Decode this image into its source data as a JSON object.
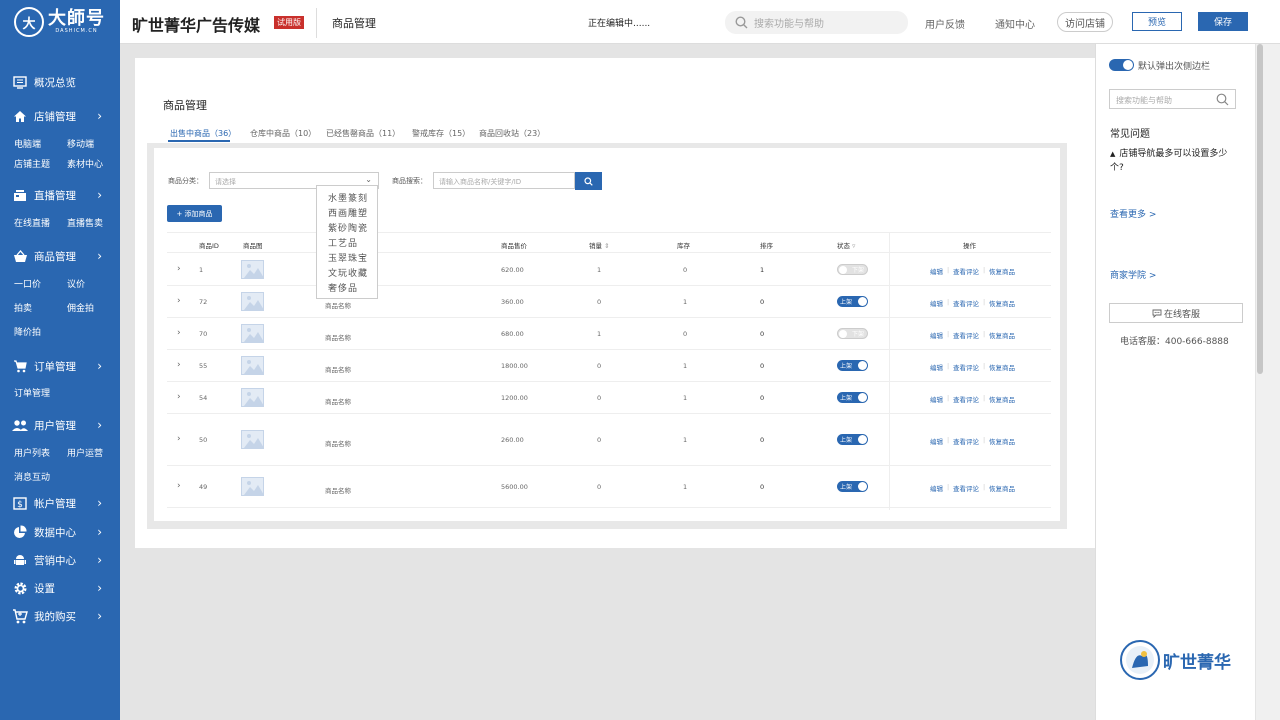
{
  "sidebar": {
    "logo_mark": "大",
    "logo_text": "大師号",
    "logo_sub": "DASHICM.CN",
    "items": [
      {
        "label": "概况总览",
        "subs": []
      },
      {
        "label": "店铺管理",
        "subs": [
          "电脑端",
          "移动端",
          "店铺主题",
          "素材中心"
        ]
      },
      {
        "label": "直播管理",
        "subs": [
          "在线直播",
          "直播售卖"
        ]
      },
      {
        "label": "商品管理",
        "subs": [
          "一口价",
          "议价",
          "拍卖",
          "佣金拍",
          "降价拍"
        ]
      },
      {
        "label": "订单管理",
        "subs": [
          "订单管理"
        ]
      },
      {
        "label": "用户管理",
        "subs": [
          "用户列表",
          "用户运营",
          "消息互动"
        ]
      },
      {
        "label": "帐户管理",
        "subs": []
      },
      {
        "label": "数据中心",
        "subs": []
      },
      {
        "label": "营销中心",
        "subs": []
      },
      {
        "label": "设置",
        "subs": []
      },
      {
        "label": "我的购买",
        "subs": []
      }
    ]
  },
  "topbar": {
    "company": "旷世菁华广告传媒",
    "trial_badge": "试用版",
    "breadcrumb": "商品管理",
    "editing_status": "正在编辑中......",
    "search_placeholder": "搜索功能与帮助",
    "feedback": "用户反馈",
    "notifications": "通知中心",
    "visit_store": "访问店铺",
    "preview": "预览",
    "save": "保存"
  },
  "page": {
    "title": "商品管理",
    "tabs": [
      "出售中商品（36）",
      "仓库中商品（10）",
      "已经售罄商品（11）",
      "警戒库存（15）",
      "商品回收站（23）"
    ],
    "active_tab": 0
  },
  "filters": {
    "category_label": "商品分类：",
    "category_placeholder": "请选择",
    "search_label": "商品搜索：",
    "search_placeholder": "请输入商品名称/关键字/ID",
    "add_button": "+ 添加商品"
  },
  "category_options": [
    "水墨篆刻",
    "西画雕塑",
    "紫砂陶瓷",
    "工艺品",
    "玉翠珠宝",
    "文玩收藏",
    "奢侈品"
  ],
  "table": {
    "headers": [
      "商品ID",
      "商品图",
      "商品售价",
      "销量",
      "库存",
      "排序",
      "状态",
      "操作"
    ],
    "rows": [
      {
        "id": "1",
        "name": "",
        "price": "620.00",
        "sales": "1",
        "stock": "0",
        "sort": "1",
        "status": "下架",
        "status_on": false
      },
      {
        "id": "72",
        "name": "商品名称",
        "price": "360.00",
        "sales": "0",
        "stock": "1",
        "sort": "0",
        "status": "上架",
        "status_on": true
      },
      {
        "id": "70",
        "name": "商品名称",
        "price": "680.00",
        "sales": "1",
        "stock": "0",
        "sort": "0",
        "status": "下架",
        "status_on": false
      },
      {
        "id": "55",
        "name": "商品名称",
        "price": "1800.00",
        "sales": "0",
        "stock": "1",
        "sort": "0",
        "status": "上架",
        "status_on": true
      },
      {
        "id": "54",
        "name": "商品名称",
        "price": "1200.00",
        "sales": "0",
        "stock": "1",
        "sort": "0",
        "status": "上架",
        "status_on": true
      },
      {
        "id": "50",
        "name": "商品名称",
        "price": "260.00",
        "sales": "0",
        "stock": "1",
        "sort": "0",
        "status": "上架",
        "status_on": true
      },
      {
        "id": "49",
        "name": "商品名称",
        "price": "5600.00",
        "sales": "0",
        "stock": "1",
        "sort": "0",
        "status": "上架",
        "status_on": true
      }
    ],
    "actions": [
      "编辑",
      "查看评论",
      "恢复商品"
    ]
  },
  "right_panel": {
    "toggle_label": "默认弹出次侧边栏",
    "search_placeholder": "搜索功能与帮助",
    "faq_title": "常见问题",
    "faq_item": "店铺导航最多可以设置多少个?",
    "see_more": "查看更多 >",
    "merchant_academy": "商家学院 >",
    "service_button": "在线客服",
    "hotline": "电话客服：400-666-8888",
    "brand_name": "旷世菁华"
  },
  "colors": {
    "accent": "#2a67b1",
    "trial": "#c9302c"
  }
}
